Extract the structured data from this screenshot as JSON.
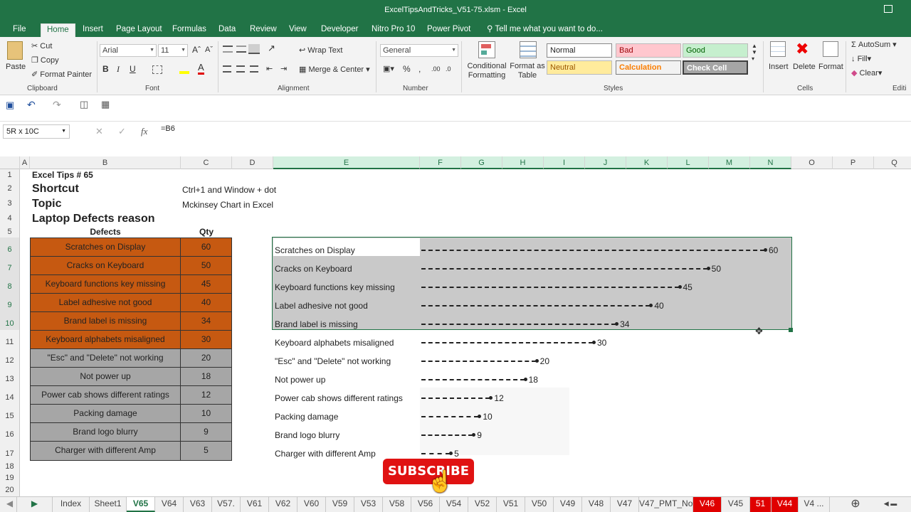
{
  "window": {
    "title": "ExcelTipsAndTricks_V51-75.xlsm - Excel"
  },
  "menu": {
    "tabs": [
      "File",
      "Home",
      "Insert",
      "Page Layout",
      "Formulas",
      "Data",
      "Review",
      "View",
      "Developer",
      "Nitro Pro 10",
      "Power Pivot"
    ],
    "active": "Home",
    "tell_me": "Tell me what you want to do..."
  },
  "ribbon": {
    "clipboard": {
      "paste": "Paste",
      "cut": "Cut",
      "copy": "Copy",
      "format_painter": "Format Painter",
      "label": "Clipboard"
    },
    "font": {
      "name": "Arial",
      "size": "11",
      "bold": "B",
      "italic": "I",
      "underline": "U",
      "label": "Font"
    },
    "alignment": {
      "wrap": "Wrap Text",
      "merge": "Merge & Center",
      "label": "Alignment"
    },
    "number": {
      "format": "General",
      "label": "Number"
    },
    "styles": {
      "conditional": "Conditional Formatting",
      "format_table": "Format as Table",
      "normal": "Normal",
      "bad": "Bad",
      "good": "Good",
      "neutral": "Neutral",
      "calculation": "Calculation",
      "check_cell": "Check Cell",
      "label": "Styles"
    },
    "cells": {
      "insert": "Insert",
      "delete": "Delete",
      "format": "Format",
      "label": "Cells"
    },
    "editing": {
      "autosum": "AutoSum",
      "fill": "Fill",
      "clear": "Clear",
      "label": "Editi"
    }
  },
  "formula_bar": {
    "name_box": "5R x 10C",
    "formula": "=B6"
  },
  "columns": [
    "A",
    "B",
    "C",
    "D",
    "E",
    "F",
    "G",
    "H",
    "I",
    "J",
    "K",
    "L",
    "M",
    "N",
    "O",
    "P",
    "Q"
  ],
  "rows": [
    "1",
    "2",
    "3",
    "4",
    "5",
    "6",
    "7",
    "8",
    "9",
    "10",
    "11",
    "12",
    "13",
    "14",
    "15",
    "16",
    "17",
    "18",
    "19",
    "20"
  ],
  "sheet": {
    "b1": "Excel Tips # 65",
    "b2": "Shortcut",
    "c2": "Ctrl+1 and Window + dot",
    "b3": "Topic",
    "c3": "Mckinsey Chart in Excel",
    "b4": "Laptop Defects reason",
    "hdr_defects": "Defects",
    "hdr_qty": "Qty",
    "table": [
      {
        "defect": "Scratches on Display",
        "qty": "60"
      },
      {
        "defect": "Cracks on Keyboard",
        "qty": "50"
      },
      {
        "defect": "Keyboard functions key missing",
        "qty": "45"
      },
      {
        "defect": "Label adhesive not good",
        "qty": "40"
      },
      {
        "defect": "Brand label is missing",
        "qty": "34"
      },
      {
        "defect": "Keyboard alphabets misaligned",
        "qty": "30"
      },
      {
        "defect": "\"Esc\" and \"Delete\" not working",
        "qty": "20"
      },
      {
        "defect": "Not power up",
        "qty": "18"
      },
      {
        "defect": "Power cab shows different ratings",
        "qty": "12"
      },
      {
        "defect": "Packing damage",
        "qty": "10"
      },
      {
        "defect": "Brand logo blurry",
        "qty": "9"
      },
      {
        "defect": "Charger with different Amp",
        "qty": "5"
      }
    ]
  },
  "chart_data": {
    "type": "bar",
    "categories": [
      "Scratches on Display",
      "Cracks on Keyboard",
      "Keyboard functions key missing",
      "Label adhesive not good",
      "Brand label is missing",
      "Keyboard alphabets misaligned",
      "\"Esc\" and \"Delete\" not working",
      "Not power up",
      "Power cab shows different ratings",
      "Packing damage",
      "Brand logo blurry",
      "Charger with different Amp"
    ],
    "values": [
      60,
      50,
      45,
      40,
      34,
      30,
      20,
      18,
      12,
      10,
      9,
      5
    ]
  },
  "tabs": [
    "Index",
    "Sheet1",
    "V65",
    "V64",
    "V63",
    "V57.",
    "V61",
    "V62",
    "V60",
    "V59",
    "V53",
    "V58",
    "V56",
    "V54",
    "V52",
    "V51",
    "V50",
    "V49",
    "V48",
    "V47",
    "V47_PMT_No",
    "V46",
    "V45",
    "51",
    "V44",
    "V4 ..."
  ],
  "active_tab": "V65",
  "red_tabs": [
    "V46",
    "51",
    "V44"
  ],
  "overlay": {
    "subscribe": "SUBSCRIBE"
  },
  "colors": {
    "excel_green": "#217346",
    "orange": "#c65911",
    "gray": "#a6a6a6",
    "red": "#e01212"
  }
}
